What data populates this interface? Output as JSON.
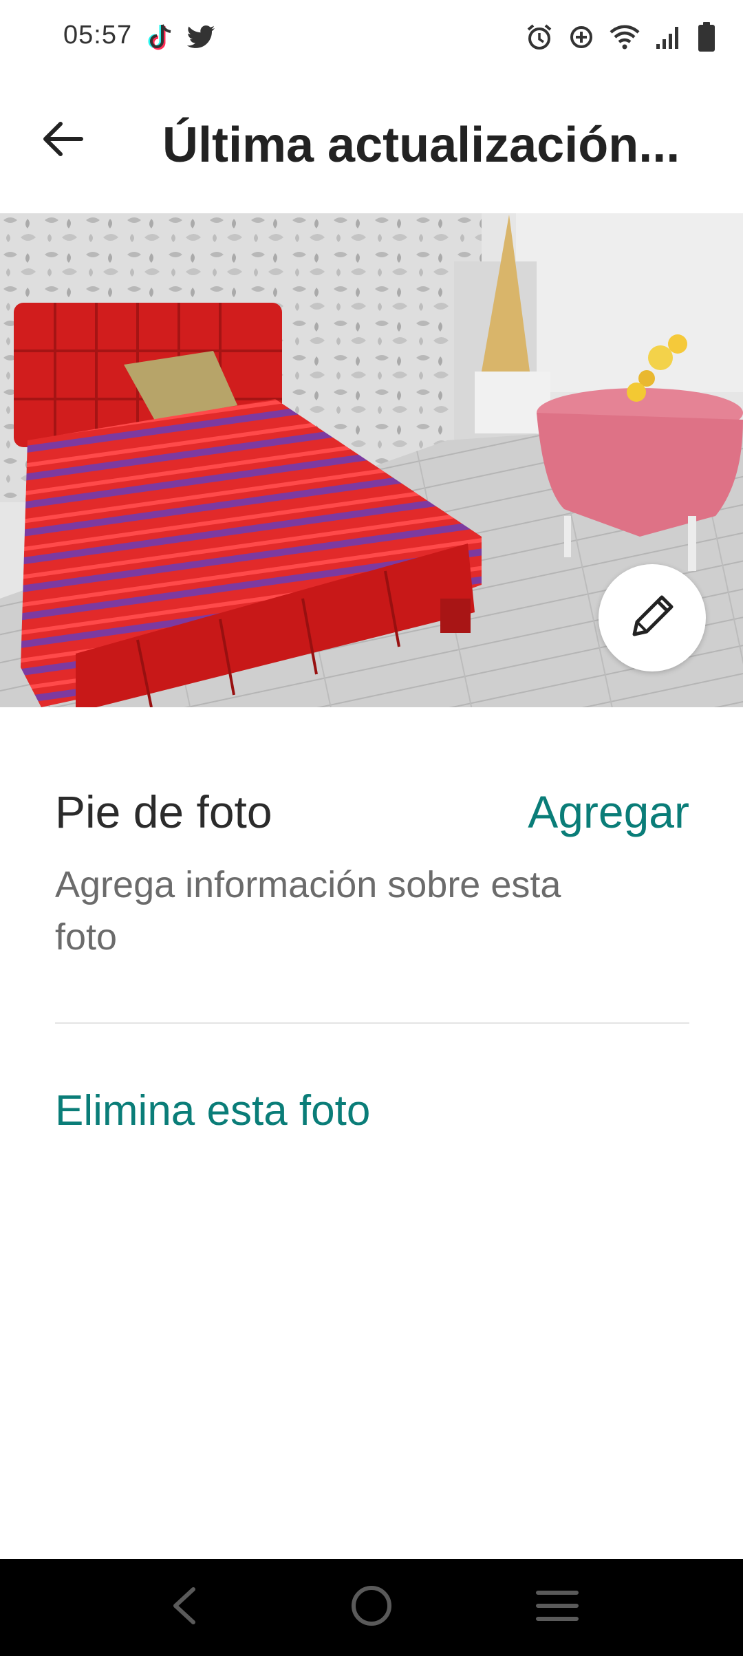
{
  "status_bar": {
    "time": "05:57",
    "left_icons": [
      "tiktok-icon",
      "twitter-icon"
    ],
    "right_icons": [
      "alarm-icon",
      "data-saver-icon",
      "wifi-icon",
      "signal-icon",
      "battery-icon"
    ]
  },
  "app_bar": {
    "back_icon": "arrow-left-icon",
    "title": "Última actualización..."
  },
  "photo": {
    "edit_icon": "pencil-icon"
  },
  "caption": {
    "heading": "Pie de foto",
    "add_label": "Agregar",
    "description": "Agrega información sobre esta foto"
  },
  "actions": {
    "delete_label": "Elimina esta foto"
  },
  "nav_bar": {
    "icons": [
      "back-chevron-icon",
      "home-circle-icon",
      "menu-icon"
    ]
  },
  "colors": {
    "accent": "#0a7d78",
    "text_primary": "#222222",
    "text_secondary": "#6b6b6b",
    "divider": "#e4e4e4"
  }
}
